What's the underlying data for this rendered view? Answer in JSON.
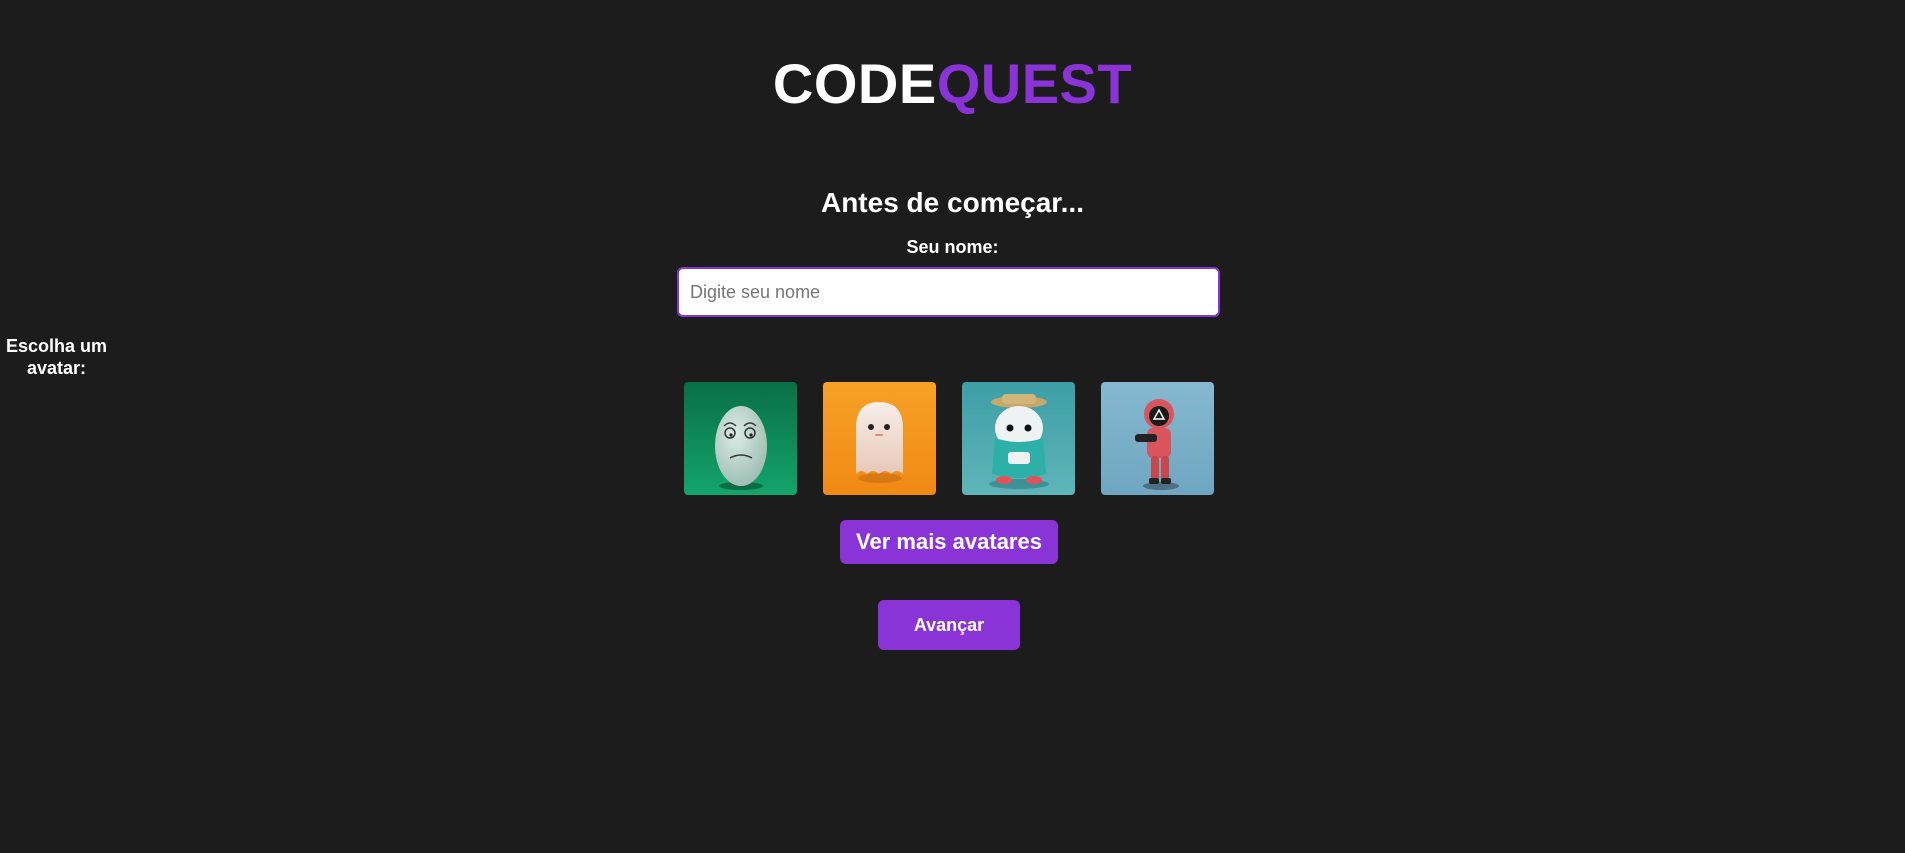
{
  "logo": {
    "part1": "CODE",
    "part2": "QUEST"
  },
  "form": {
    "heading": "Antes de começar...",
    "name_label": "Seu nome:",
    "name_input": {
      "value": "",
      "placeholder": "Digite seu nome"
    },
    "avatar_label": "Escolha um avatar:",
    "avatars": [
      {
        "icon": "sad-egg-avatar",
        "background": "#0f8a5a"
      },
      {
        "icon": "ghost-avatar",
        "background": "#f59a1e"
      },
      {
        "icon": "explorer-creature-avatar",
        "background": "#3a9fa6"
      },
      {
        "icon": "masked-guard-avatar",
        "background": "#7fb3cc"
      }
    ],
    "more_avatars_label": "Ver mais avatares",
    "next_label": "Avançar"
  },
  "colors": {
    "background": "#1c1c1c",
    "accent": "#8a33d6",
    "text": "#ffffff"
  }
}
